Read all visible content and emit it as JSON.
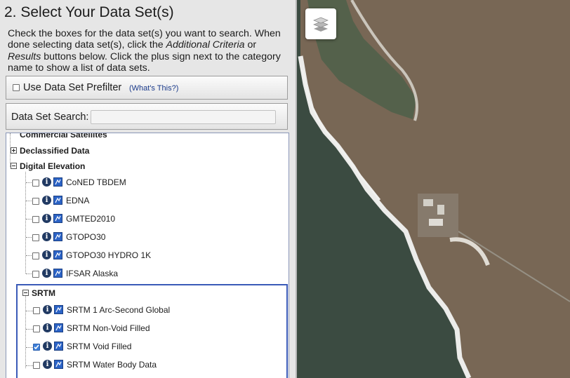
{
  "panel": {
    "heading": "2. Select Your Data Set(s)",
    "instructions": {
      "part1": "Check the boxes for the data set(s) you want to search. When done selecting data set(s), click the ",
      "additional_criteria": "Additional Criteria",
      "part2": " or ",
      "results": "Results",
      "part3": " buttons below. Click the plus sign next to the category name to show a list of data sets."
    },
    "prefilter": {
      "label": "Use Data Set Prefilter",
      "help": "(What's This?)",
      "checked": false
    },
    "search": {
      "label": "Data Set Search:",
      "value": "",
      "placeholder": ""
    },
    "tree": {
      "categories": [
        {
          "label": "Commercial Satellites",
          "expanded": false
        },
        {
          "label": "Declassified Data",
          "expanded": false
        },
        {
          "label": "Digital Elevation",
          "expanded": true
        }
      ],
      "digital_elevation": [
        {
          "name": "CoNED TBDEM",
          "checked": false
        },
        {
          "name": "EDNA",
          "checked": false
        },
        {
          "name": "GMTED2010",
          "checked": false
        },
        {
          "name": "GTOPO30",
          "checked": false
        },
        {
          "name": "GTOPO30 HYDRO 1K",
          "checked": false
        },
        {
          "name": "IFSAR Alaska",
          "checked": false
        }
      ],
      "srtm": {
        "label": "SRTM",
        "expanded": true,
        "items": [
          {
            "name": "SRTM 1 Arc-Second Global",
            "checked": false
          },
          {
            "name": "SRTM Non-Void Filled",
            "checked": false
          },
          {
            "name": "SRTM Void Filled",
            "checked": true
          },
          {
            "name": "SRTM Water Body Data",
            "checked": false
          }
        ]
      }
    }
  },
  "map": {
    "layers_icon": "layers-icon",
    "colors": {
      "ocean": "#3d4d43",
      "land": "#7b6a58",
      "surf": "#f2f2f0"
    }
  }
}
